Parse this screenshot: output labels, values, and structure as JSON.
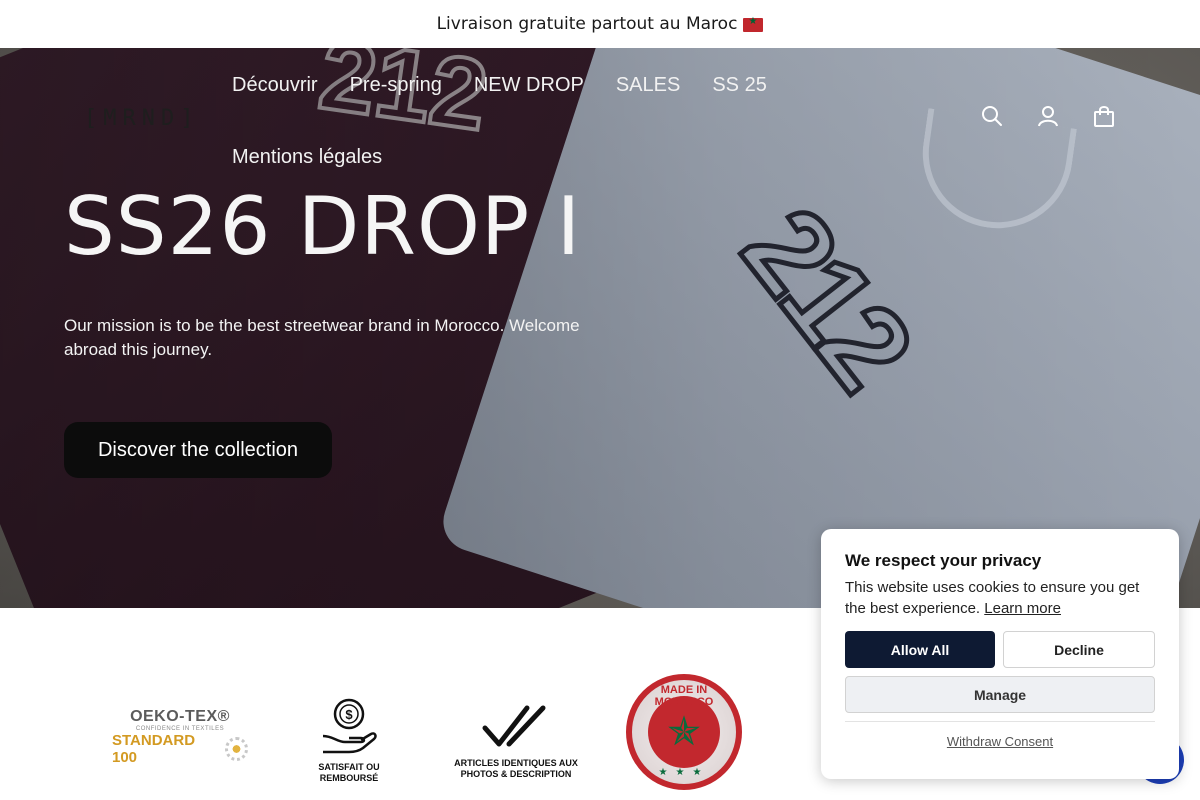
{
  "announcement": {
    "text": "Livraison gratuite partout au Maroc",
    "flag": "🇲🇦"
  },
  "brand": {
    "logo_text": "[MRND]"
  },
  "nav": {
    "items": [
      "Découvrir",
      "Pre-spring",
      "NEW DROP",
      "SALES",
      "SS 25",
      "Mentions légales"
    ]
  },
  "header_icons": [
    "search-icon",
    "account-icon",
    "cart-icon"
  ],
  "hero": {
    "title": "SS26 DROP I",
    "text": "Our mission is to be the best streetwear brand in Morocco. Welcome abroad this journey.",
    "cta_label": "Discover the collection",
    "shirt_print": "212"
  },
  "badges": {
    "oeko_line1": "OEKO-TEX®",
    "oeko_line2": "CONFIDENCE IN TEXTILES",
    "oeko_line3": "STANDARD 100",
    "satisfied_caption": "SATISFAIT OU REMBOURSÉ",
    "identical_caption": "ARTICLES IDENTIQUES AUX PHOTOS & DESCRIPTION",
    "made_in_caption": "MADE IN MOROCCO"
  },
  "cookie_banner": {
    "title": "We respect your privacy",
    "body": "This website uses cookies to ensure you get the best experience.",
    "learn_more": "Learn more",
    "allow_all": "Allow All",
    "decline": "Decline",
    "manage": "Manage",
    "withdraw": "Withdraw Consent"
  },
  "colors": {
    "cta_bg": "#0c0c0c",
    "allow_bg": "#0e1a33",
    "chat_bubble": "#1d3fb8",
    "moroccan_red": "#c2282e"
  }
}
